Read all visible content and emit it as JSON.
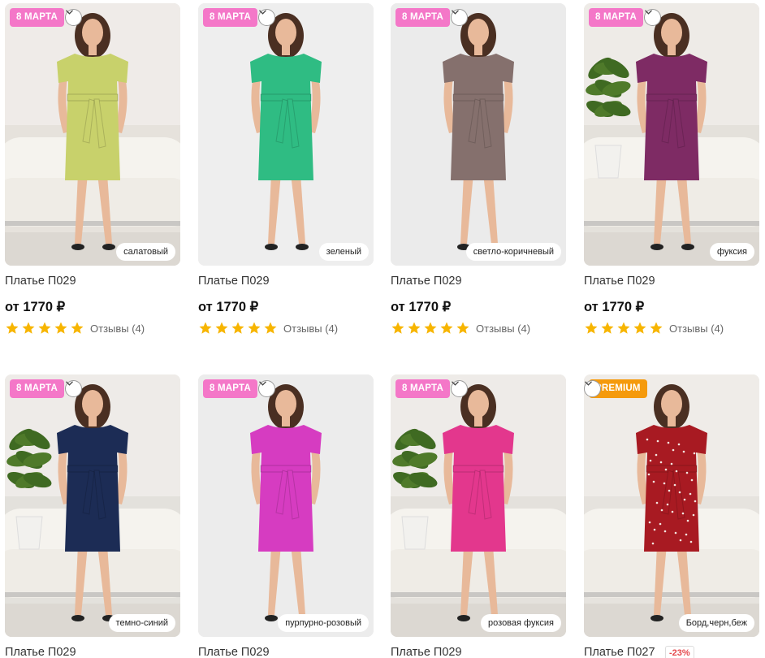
{
  "products": [
    {
      "badge": "8 МАРТА",
      "badge_type": "8march",
      "color_label": "салатовый",
      "name": "Платье П029",
      "price": "от 1770 ₽",
      "reviews": "Отзывы (4)",
      "rating": 5,
      "dress_color": "#c8d16b",
      "bg": "#e6e2dc",
      "has_plant": false,
      "has_sofa": true
    },
    {
      "badge": "8 МАРТА",
      "badge_type": "8march",
      "color_label": "зеленый",
      "name": "Платье П029",
      "price": "от 1770 ₽",
      "reviews": "Отзывы (4)",
      "rating": 5,
      "dress_color": "#2fbc83",
      "bg": "#eeeeee",
      "has_plant": false,
      "has_sofa": false
    },
    {
      "badge": "8 МАРТА",
      "badge_type": "8march",
      "color_label": "светло-коричневый",
      "name": "Платье П029",
      "price": "от 1770 ₽",
      "reviews": "Отзывы (4)",
      "rating": 5,
      "dress_color": "#85706d",
      "bg": "#ebebeb",
      "has_plant": false,
      "has_sofa": false
    },
    {
      "badge": "8 МАРТА",
      "badge_type": "8march",
      "color_label": "фуксия",
      "name": "Платье П029",
      "price": "от 1770 ₽",
      "reviews": "Отзывы (4)",
      "rating": 5,
      "dress_color": "#7e2b64",
      "bg": "#e4e1db",
      "has_plant": true,
      "has_sofa": true
    },
    {
      "badge": "8 МАРТА",
      "badge_type": "8march",
      "color_label": "темно-синий",
      "name": "Платье П029",
      "price": "",
      "reviews": "",
      "rating": 0,
      "dress_color": "#1c2c55",
      "bg": "#e3e1dc",
      "has_plant": true,
      "has_sofa": true
    },
    {
      "badge": "8 МАРТА",
      "badge_type": "8march",
      "color_label": "пурпурно-розовый",
      "name": "Платье П029",
      "price": "",
      "reviews": "",
      "rating": 0,
      "dress_color": "#d63cc1",
      "bg": "#ececec",
      "has_plant": false,
      "has_sofa": false
    },
    {
      "badge": "8 МАРТА",
      "badge_type": "8march",
      "color_label": "розовая фуксия",
      "name": "Платье П029",
      "price": "",
      "reviews": "",
      "rating": 0,
      "dress_color": "#e3378d",
      "bg": "#e4e1dc",
      "has_plant": true,
      "has_sofa": true
    },
    {
      "badge": "PREMIUM",
      "badge_type": "premium",
      "color_label": "Борд,черн,беж",
      "name": "Платье П027",
      "discount": "-23%",
      "price": "",
      "reviews": "",
      "rating": 0,
      "dress_color": "#a81a22",
      "bg": "#e6e3de",
      "has_plant": false,
      "has_sofa": true
    }
  ],
  "colors": {
    "star": "#f7b500",
    "badge_8march": "#f477c8",
    "badge_premium": "#f59a0c",
    "discount_text": "#e5484d"
  }
}
